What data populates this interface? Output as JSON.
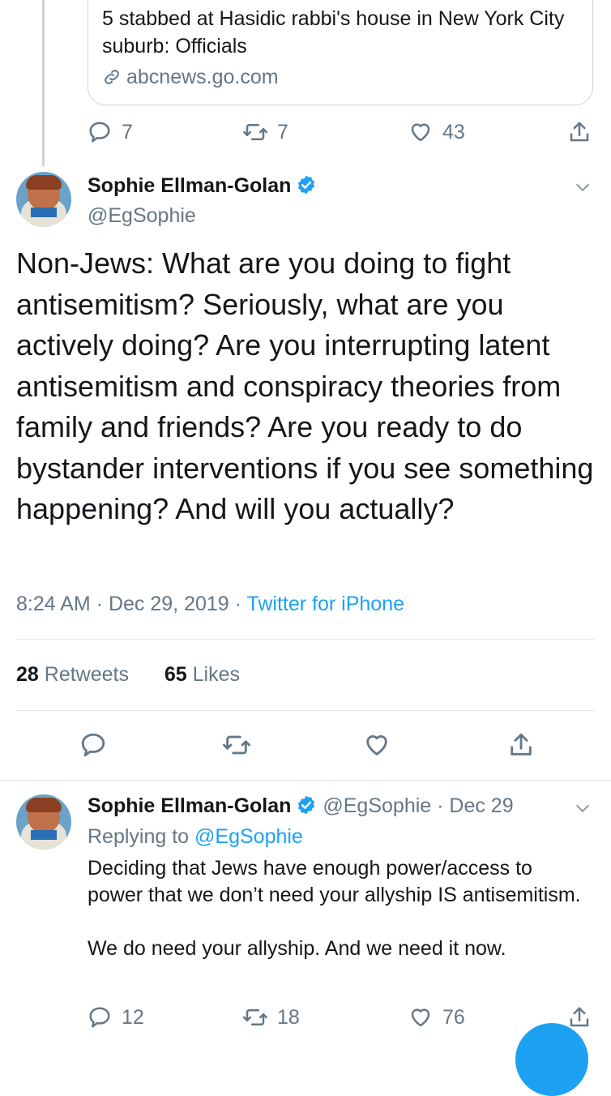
{
  "quoted_card": {
    "title": "5 stabbed at Hasidic rabbi's house in New York City suburb: Officials",
    "domain": "abcnews.go.com"
  },
  "prev_tweet_actions": {
    "replies": "7",
    "retweets": "7",
    "likes": "43"
  },
  "main_tweet": {
    "author_name": "Sophie Ellman-Golan",
    "author_handle": "@EgSophie",
    "text": "Non-Jews: What are you doing to fight antisemitism? Seriously, what are you actively doing? Are you interrupting latent antisemitism and conspiracy theories from family and friends? Are you ready to do bystander interventions if you see something happening? And will you actually?",
    "time": "8:24 AM",
    "date": "Dec 29, 2019",
    "source": "Twitter for iPhone",
    "retweet_count": "28",
    "retweet_label": "Retweets",
    "like_count": "65",
    "like_label": "Likes"
  },
  "reply_tweet": {
    "author_name": "Sophie Ellman-Golan",
    "author_handle": "@EgSophie",
    "date": "Dec 29",
    "replying_prefix": "Replying to",
    "replying_handle": "@EgSophie",
    "text": "Deciding that Jews have enough power/access to power that we don’t need your allyship IS antisemitism.\n\nWe do need your allyship. And we need it now.",
    "replies": "12",
    "retweets": "18",
    "likes": "76"
  },
  "colors": {
    "accent": "#1da1f2",
    "muted": "#657786",
    "text": "#14171a",
    "divider": "#e1e8ed"
  }
}
